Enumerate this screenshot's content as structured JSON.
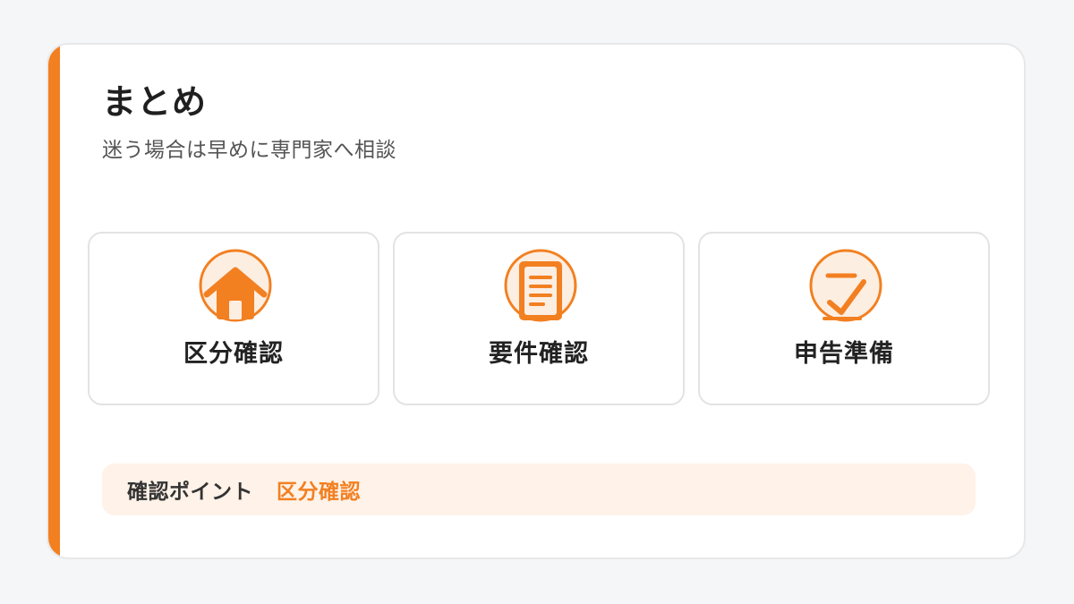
{
  "colors": {
    "accent": "#f28021",
    "accent_light": "#fff2e8",
    "icon_fill": "#fdeee2",
    "page_background": "#f5f6f8",
    "card_background": "#ffffff",
    "title_text": "#1f1f1f",
    "subtitle_text": "#555555"
  },
  "summary": {
    "title": "まとめ",
    "subtitle": "迷う場合は早めに専門家へ相談"
  },
  "tiles": [
    {
      "icon": "house-icon",
      "label": "区分確認"
    },
    {
      "icon": "document-icon",
      "label": "要件確認"
    },
    {
      "icon": "checkmark-icon",
      "label": "申告準備"
    }
  ],
  "point": {
    "label": "確認ポイント",
    "value": "区分確認"
  }
}
